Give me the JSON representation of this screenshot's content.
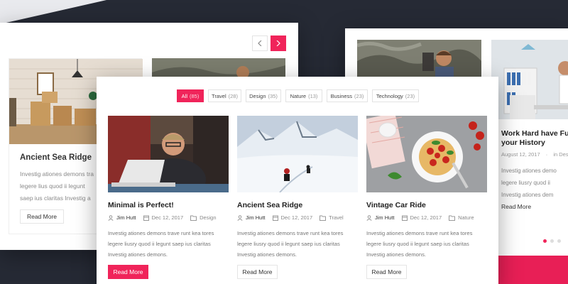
{
  "left_panel": {
    "prev_icon": "chevron-left-icon",
    "next_icon": "chevron-right-icon",
    "card": {
      "title": "Ancient Sea Ridge",
      "text_lines": [
        "Investig ationes demons tra",
        "legere lius quod ii legunt",
        "saep ius claritas Investig a"
      ],
      "read_more": "Read More"
    }
  },
  "filters": [
    {
      "label": "All",
      "count": "(85)",
      "active": true
    },
    {
      "label": "Travel",
      "count": "(28)"
    },
    {
      "label": "Design",
      "count": "(35)"
    },
    {
      "label": "Nature",
      "count": "(13)"
    },
    {
      "label": "Business",
      "count": "(23)"
    },
    {
      "label": "Technology",
      "count": "(23)"
    }
  ],
  "posts": [
    {
      "title": "Minimal is Perfect!",
      "author": "Jim Hutt",
      "date": "Dec 12, 2017",
      "category": "Design",
      "text_lines": [
        "Investig ationes demons trave runt kea tores",
        "legere liusry quod ii legunt saep ius claritas",
        "Investig ationes demons."
      ],
      "read_more": "Read More"
    },
    {
      "title": "Ancient Sea Ridge",
      "author": "Jim Hutt",
      "date": "Dec 12, 2017",
      "category": "Travel",
      "text_lines": [
        "Investig ationes demons trave runt kea tores",
        "legere liusry quod ii legunt saep ius claritas",
        "Investig ationes demons."
      ],
      "read_more": "Read More"
    },
    {
      "title": "Vintage Car Ride",
      "author": "Jim Hutt",
      "date": "Dec 12, 2017",
      "category": "Nature",
      "text_lines": [
        "Investig ationes demons trave runt kea tores",
        "legere liusry quod ii legunt saep ius claritas",
        "Investig ationes demons."
      ],
      "read_more": "Read More"
    }
  ],
  "right_panel": {
    "title_lines": [
      "Work Hard have Fun",
      "your History"
    ],
    "date": "August 12, 2017",
    "meta_extra": "in Des",
    "text_lines": [
      "Investig ationes demo",
      "legere liusry quod ii",
      "Investig ationes dem"
    ],
    "read_more": "Read More"
  },
  "colors": {
    "accent": "#f0245a",
    "background": "#262a35"
  }
}
